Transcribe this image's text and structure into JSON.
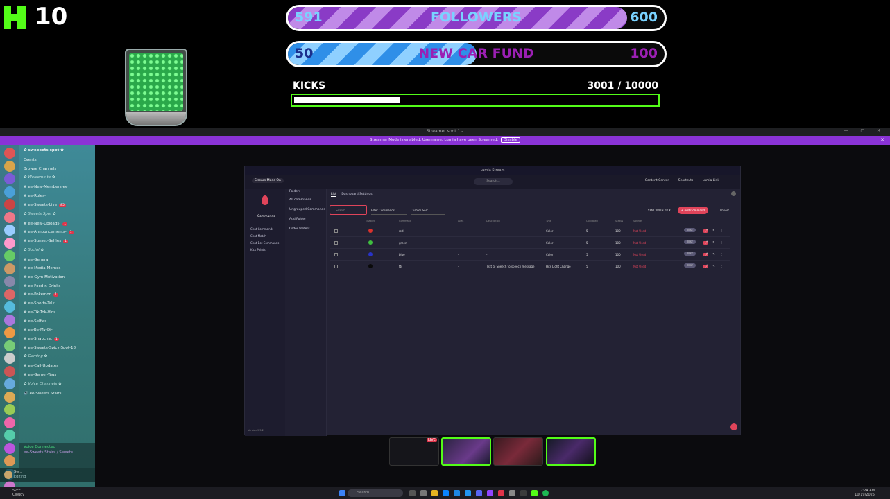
{
  "overlay": {
    "kick_count": "10",
    "followers_goal": {
      "start": "591",
      "label": "FOLLOWERS",
      "end": "600",
      "progress": 0.9
    },
    "car_fund_goal": {
      "start": "50",
      "label": "NEW CAR FUND",
      "end": "100",
      "progress": 0.5
    },
    "kicks_goal": {
      "label": "KICKS",
      "value": "3001  / 10000",
      "progress": 0.3
    }
  },
  "discord": {
    "window_title": "Streamer spot 1 – ",
    "streamer_banner": "Streamer Mode is enabled. Username, Lumia have been Streamed.",
    "banner_action": "Disable",
    "server_name": "✿ sweeeets spot ✿",
    "channels": [
      {
        "label": "Events",
        "type": "item"
      },
      {
        "label": "Browse Channels",
        "type": "item"
      },
      {
        "label": "✿ Welcome to ✿",
        "type": "category"
      },
      {
        "label": "#  ee-New-Members-ee",
        "type": "item"
      },
      {
        "label": "#  ee-Rules-",
        "type": "item"
      },
      {
        "label": "#  ee-Sweets-Live",
        "type": "item",
        "badge": "85"
      },
      {
        "label": "✿ Sweets Spot ✿",
        "type": "category"
      },
      {
        "label": "#  ee-New-Uploads-",
        "type": "item",
        "badge": "1"
      },
      {
        "label": "#  ee-Announcements-",
        "type": "item",
        "badge": "1"
      },
      {
        "label": "#  ee-Sunset-Selfies",
        "type": "item",
        "badge": "1"
      },
      {
        "label": "✿ Social ✿",
        "type": "category"
      },
      {
        "label": "#  ee-General",
        "type": "item"
      },
      {
        "label": "#  ee-Media-Memes-",
        "type": "item"
      },
      {
        "label": "#  ee-Gym-Motivation-",
        "type": "item"
      },
      {
        "label": "#  ee-Food-n-Drinks-",
        "type": "item"
      },
      {
        "label": "#  ee-Pokemon",
        "type": "item",
        "badge": "1"
      },
      {
        "label": "#  ee-Sports-Talk",
        "type": "item"
      },
      {
        "label": "#  ee-Tik-Tok-Vids",
        "type": "item"
      },
      {
        "label": "#  ee-Selfies",
        "type": "item"
      },
      {
        "label": "#  ee-Be-My-Dj-",
        "type": "item"
      },
      {
        "label": "#  ee-Snapchat",
        "type": "item",
        "badge": "1"
      },
      {
        "label": "#  ee-Sweets-Spicy-Spot-18",
        "type": "item"
      },
      {
        "label": "✿ Gaming ✿",
        "type": "category"
      },
      {
        "label": "#  ee-Call-Updates",
        "type": "item"
      },
      {
        "label": "#  ee-Gamer-Tags",
        "type": "item"
      },
      {
        "label": "✿ Voice Channels ✿",
        "type": "category"
      },
      {
        "label": "🔊  ee-Sweets Stairs",
        "type": "item"
      }
    ],
    "voice_status": "Voice Connected",
    "voice_sub": "ee-Sweets Stairs / Sweets",
    "user_name": "Sw...",
    "user_status": "Editing"
  },
  "lumia": {
    "title": "Lumia Stream",
    "stream_mode_button": "Stream Mode On",
    "search_placeholder": "Search...",
    "nav": [
      "Content Center",
      "Shortcuts",
      "Lumia Link"
    ],
    "left_title": "Commands",
    "left_items": [
      "Chat Commands",
      "Chat Match",
      "Chat Bot Commands",
      "Kick Points"
    ],
    "version": "Version 9.5.2",
    "folders": [
      "Folders",
      "All commands",
      "Ungrouped Commands",
      "Add Folder",
      "Order folders"
    ],
    "tabs": [
      "List",
      "Dashboard Settings"
    ],
    "filter_search": "Search",
    "filter_commands": "Filter Commands",
    "sort_by": "Custom Sort",
    "sync_label": "SYNC WITH KICK",
    "add_command": "+ Add Command",
    "import_label": "Import",
    "columns": [
      "",
      "Enabled",
      "Command",
      "Alias",
      "Description",
      "Type",
      "Cooldown",
      "Status",
      "Source"
    ],
    "rows": [
      {
        "color": "#d9322d",
        "command": "red",
        "alias": "-",
        "description": "-",
        "type": "Color",
        "cooldown": "5",
        "status": "100",
        "state": "Not Used"
      },
      {
        "color": "#3fbf3f",
        "command": "green",
        "alias": "-",
        "description": "-",
        "type": "Color",
        "cooldown": "5",
        "status": "100",
        "state": "Not Used"
      },
      {
        "color": "#2833c9",
        "command": "blue",
        "alias": "-",
        "description": "-",
        "type": "Color",
        "cooldown": "5",
        "status": "100",
        "state": "Not Used"
      },
      {
        "color": "#0a0a0a",
        "command": "tts",
        "alias": "-",
        "description": "Text to Speech to speech message",
        "type": "Hits Light Change",
        "cooldown": "5",
        "status": "100",
        "state": "Not Used"
      }
    ],
    "test_label": "TEST"
  },
  "taskbar": {
    "weather_temp": "57°F",
    "weather_text": "Cloudy",
    "search": "Search",
    "time": "2:24 AM",
    "date": "10/19/2025"
  }
}
